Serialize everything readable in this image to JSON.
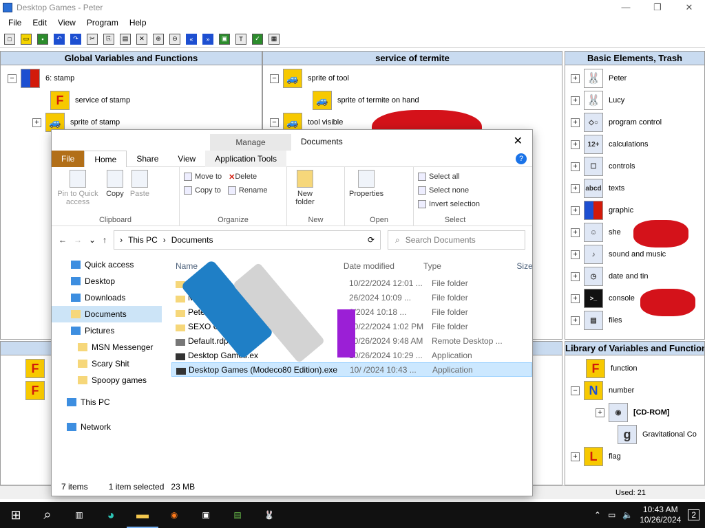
{
  "app": {
    "title": "Desktop Games - Peter",
    "window_buttons": [
      "—",
      "❐",
      "✕"
    ],
    "menu": [
      "File",
      "Edit",
      "View",
      "Program",
      "Help"
    ],
    "toolbar_icons": [
      "new-icon",
      "open-icon",
      "save-icon",
      "undo-icon",
      "redo-icon",
      "cut-icon",
      "copy-icon",
      "paste-icon",
      "delete-icon",
      "zoom-in-icon",
      "zoom-out-icon",
      "rewind-icon",
      "forward-icon",
      "lock-icon",
      "text-icon",
      "check-icon",
      "image-icon"
    ]
  },
  "panels": {
    "global": {
      "header": "Global Variables and Functions",
      "items": [
        {
          "expander": "−",
          "label": "6: stamp"
        },
        {
          "expander": "",
          "label": "service of stamp"
        },
        {
          "expander": "+",
          "label": "sprite of stamp"
        }
      ]
    },
    "service": {
      "header": "service of termite",
      "items": [
        {
          "expander": "−",
          "label": "sprite of tool"
        },
        {
          "expander": "",
          "label": "sprite of termite on hand"
        },
        {
          "expander": "−",
          "label": "tool visible"
        }
      ]
    },
    "basic": {
      "header": "Basic Elements, Trash",
      "items": [
        {
          "label": "Peter"
        },
        {
          "label": "Lucy"
        },
        {
          "label": "program control"
        },
        {
          "label": "calculations"
        },
        {
          "label": "controls"
        },
        {
          "label": "texts"
        },
        {
          "label": "graphic"
        },
        {
          "label": "she"
        },
        {
          "label": "sound and music"
        },
        {
          "label": "date and tin"
        },
        {
          "label": "console"
        },
        {
          "label": "files"
        }
      ]
    },
    "library": {
      "header": "Library of Variables and Functions",
      "items": [
        {
          "expander": "",
          "label": "function"
        },
        {
          "expander": "−",
          "label": "number"
        },
        {
          "expander": "+",
          "label": "[CD-ROM]"
        },
        {
          "expander": "",
          "label": "Gravitational Co"
        },
        {
          "expander": "+",
          "label": "flag"
        }
      ]
    },
    "status_used": "Used: 21"
  },
  "explorer": {
    "manage_label": "Manage",
    "title": "Documents",
    "tabs": [
      "File",
      "Home",
      "Share",
      "View",
      "Application Tools"
    ],
    "ribbon": {
      "clipboard": {
        "label": "Clipboard",
        "pin": "Pin to Quick access",
        "copy": "Copy",
        "paste": "Paste"
      },
      "organize": {
        "label": "Organize",
        "move_to": "Move to",
        "delete": "Delete",
        "copy_to": "Copy to",
        "rename": "Rename"
      },
      "new": {
        "label": "New",
        "new_folder": "New folder"
      },
      "open": {
        "label": "Open",
        "properties": "Properties"
      },
      "select": {
        "label": "Select",
        "select_all": "Select all",
        "select_none": "Select none",
        "invert": "Invert selection"
      }
    },
    "address": {
      "this_pc": "This PC",
      "documents": "Documents",
      "search_placeholder": "Search Documents"
    },
    "columns": [
      "Name",
      "Date modified",
      "Type",
      "Size"
    ],
    "nav": [
      {
        "label": "Quick access",
        "sel": false
      },
      {
        "label": "Desktop",
        "sel": false
      },
      {
        "label": "Downloads",
        "sel": false
      },
      {
        "label": "Documents",
        "sel": true
      },
      {
        "label": "Pictures",
        "sel": false
      },
      {
        "label": "MSN Messenger",
        "sel": false
      },
      {
        "label": "Scary Shit",
        "sel": false
      },
      {
        "label": "Spoopy games",
        "sel": false
      },
      {
        "label": "This PC",
        "sel": false
      },
      {
        "label": "Network",
        "sel": false
      }
    ],
    "files": [
      {
        "name": "Fide",
        "date": "10/22/2024 12:01 ...",
        "type": "File folder",
        "sel": false
      },
      {
        "name": "My Re",
        "date": "26/2024 10:09 ...",
        "type": "File folder",
        "sel": false
      },
      {
        "name": "Peter",
        "date": "6/2024 10:18 ...",
        "type": "File folder",
        "sel": false
      },
      {
        "name": "SEXO CATINC",
        "date": "10/22/2024 1:02 PM",
        "type": "File folder",
        "sel": false
      },
      {
        "name": "Default.rdp",
        "date": "10/26/2024 9:48 AM",
        "type": "Remote Desktop ...",
        "sel": false
      },
      {
        "name": "Desktop Games.ex",
        "date": "10/26/2024 10:29 ...",
        "type": "Application",
        "sel": false
      },
      {
        "name": "Desktop Games (Modeco80 Edition).exe",
        "date": "10/ /2024 10:43 ...",
        "type": "Application",
        "sel": true
      }
    ],
    "status": {
      "items": "7 items",
      "selected": "1 item selected",
      "size": "23 MB"
    }
  },
  "taskbar": {
    "time": "10:43 AM",
    "date": "10/26/2024",
    "notif": "2"
  }
}
